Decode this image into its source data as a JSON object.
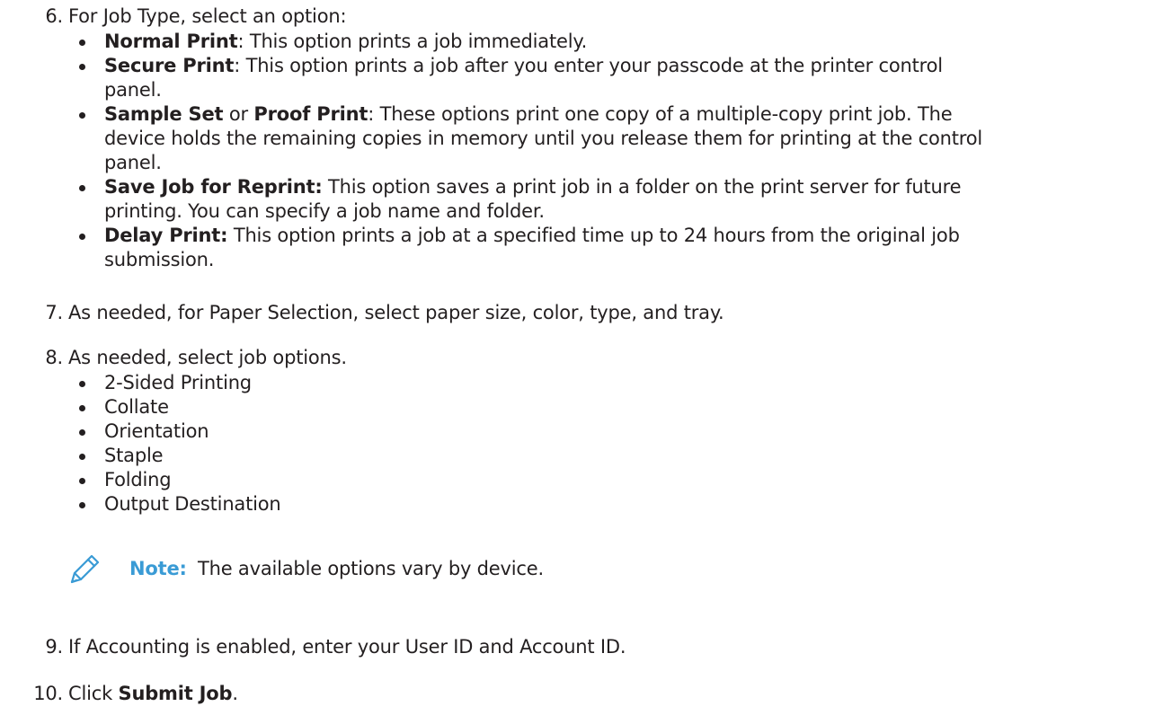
{
  "steps": {
    "s6": {
      "number": "6.",
      "text": "For Job Type, select an option:",
      "bullets": [
        {
          "bold": "Normal Print",
          "rest": ": This option prints a job immediately."
        },
        {
          "bold": "Secure Print",
          "rest": ": This option prints a job after you enter your passcode at the printer control",
          "cont": "panel."
        },
        {
          "bold": "Sample Set",
          "mid": " or ",
          "bold2": "Proof Print",
          "rest": ": These options print one copy of a multiple-copy print job. The",
          "cont": "device holds the remaining copies in memory until you release them for printing at the control",
          "cont2": "panel."
        },
        {
          "bold": "Save Job for Reprint:",
          "rest": " This option saves a print job in a folder on the print server for future",
          "cont": "printing. You can specify a job name and folder."
        },
        {
          "bold": "Delay Print:",
          "rest": " This option prints a job at a specified time up to 24 hours from the original job",
          "cont": "submission."
        }
      ]
    },
    "s7": {
      "number": "7.",
      "text": "As needed, for Paper Selection, select paper size, color, type, and tray."
    },
    "s8": {
      "number": "8.",
      "text": "As needed, select job options.",
      "options": [
        "2-Sided Printing",
        "Collate",
        "Orientation",
        "Staple",
        "Folding",
        "Output Destination"
      ]
    },
    "note": {
      "label": "Note:",
      "text": "The available options vary by device.",
      "icon": "pencil-icon",
      "color": "#3a9bd5"
    },
    "s9": {
      "number": "9.",
      "text": "If Accounting is enabled, enter your User ID and Account ID."
    },
    "s10": {
      "number": "10.",
      "text_before": "Click ",
      "bold": "Submit Job",
      "text_after": "."
    }
  }
}
